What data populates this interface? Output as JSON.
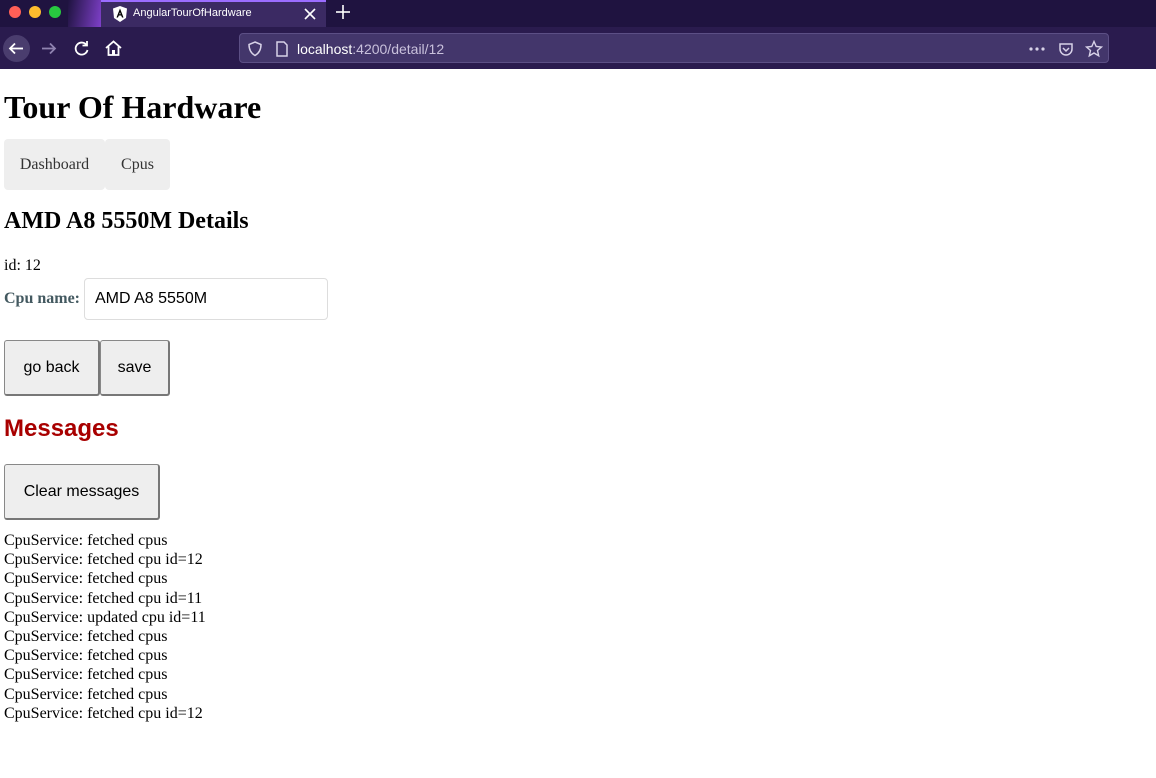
{
  "browser": {
    "tab_title": "AngularTourOfHardware",
    "url_host": "localhost",
    "url_path": ":4200/detail/12"
  },
  "app": {
    "title": "Tour Of Hardware",
    "nav": [
      "Dashboard",
      "Cpus"
    ]
  },
  "detail": {
    "heading": "AMD A8 5550M Details",
    "id_text": "id: 12",
    "name_label": "Cpu name:",
    "name_value": "AMD A8 5550M",
    "go_back_label": "go back",
    "save_label": "save"
  },
  "messages": {
    "heading": "Messages",
    "clear_label": "Clear messages",
    "items": [
      "CpuService: fetched cpus",
      "CpuService: fetched cpu id=12",
      "CpuService: fetched cpus",
      "CpuService: fetched cpu id=11",
      "CpuService: updated cpu id=11",
      "CpuService: fetched cpus",
      "CpuService: fetched cpus",
      "CpuService: fetched cpus",
      "CpuService: fetched cpus",
      "CpuService: fetched cpu id=12"
    ]
  },
  "colors": {
    "chrome_bg": "#2a1b4e",
    "messages_heading": "#a80000",
    "label_color": "#435960"
  }
}
